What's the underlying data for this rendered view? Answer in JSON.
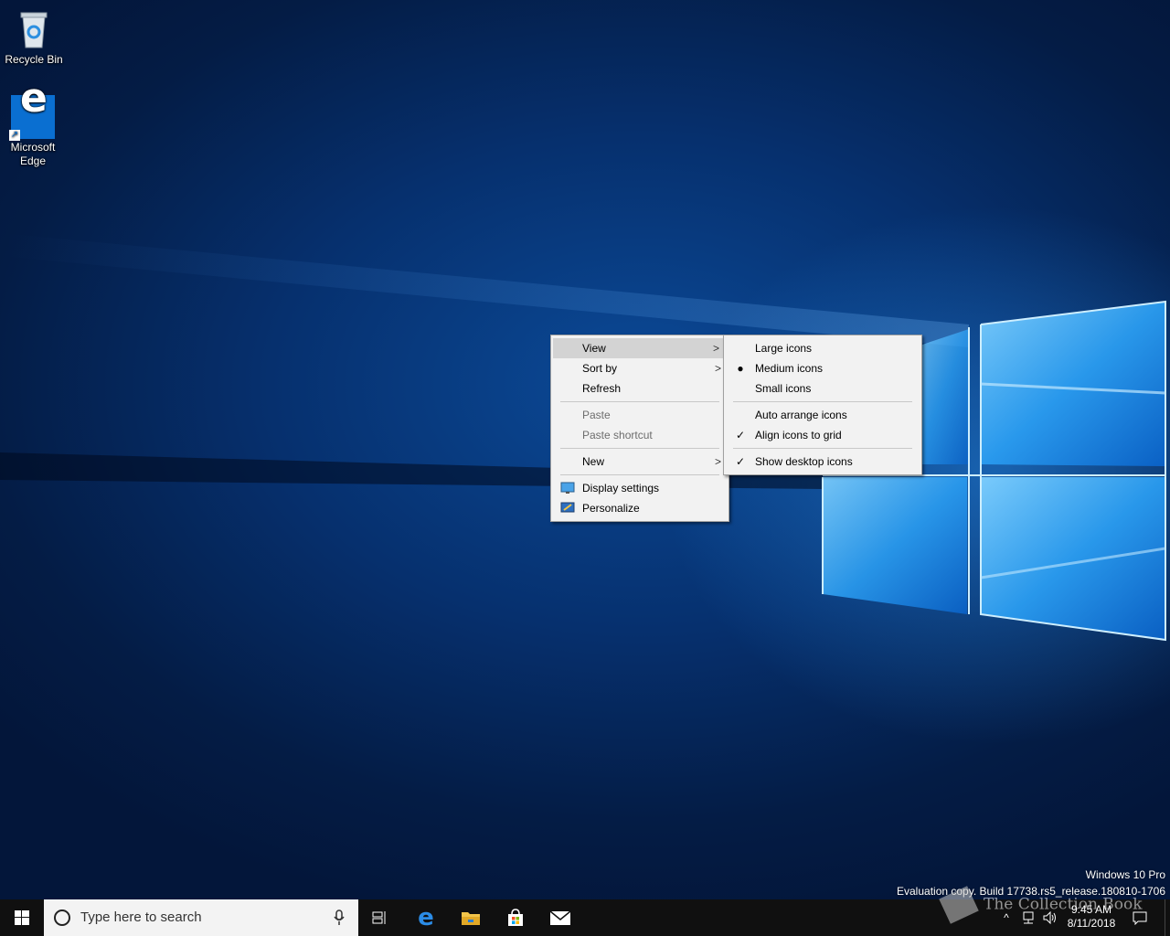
{
  "desktop_icons": [
    {
      "label": "Recycle Bin",
      "icon": "recycle-bin-icon"
    },
    {
      "label": "Microsoft Edge",
      "icon": "edge-icon"
    }
  ],
  "context_menu": {
    "view": "View",
    "sort_by": "Sort by",
    "refresh": "Refresh",
    "paste": "Paste",
    "paste_shortcut": "Paste shortcut",
    "new": "New",
    "display_settings": "Display settings",
    "personalize": "Personalize"
  },
  "view_submenu": {
    "large_icons": "Large icons",
    "medium_icons": "Medium icons",
    "small_icons": "Small icons",
    "auto_arrange": "Auto arrange icons",
    "align_to_grid": "Align icons to grid",
    "show_desktop_icons": "Show desktop icons",
    "selected_size": "Medium icons",
    "checked": [
      "Align icons to grid",
      "Show desktop icons"
    ]
  },
  "taskbar": {
    "search_placeholder": "Type here to search",
    "pinned": [
      "task-view-icon",
      "edge-icon",
      "file-explorer-icon",
      "store-icon",
      "mail-icon"
    ],
    "time": "9:45 AM",
    "date": "8/11/2018"
  },
  "watermark": {
    "edition": "Windows 10 Pro",
    "build": "Evaluation copy. Build 17738.rs5_release.180810-1706"
  },
  "overlay_logo": "The Collection Book",
  "colors": {
    "accent": "#0078d7",
    "menu_bg": "#f2f2f2",
    "menu_highlight": "#d3d3d3",
    "taskbar": "#101010"
  }
}
